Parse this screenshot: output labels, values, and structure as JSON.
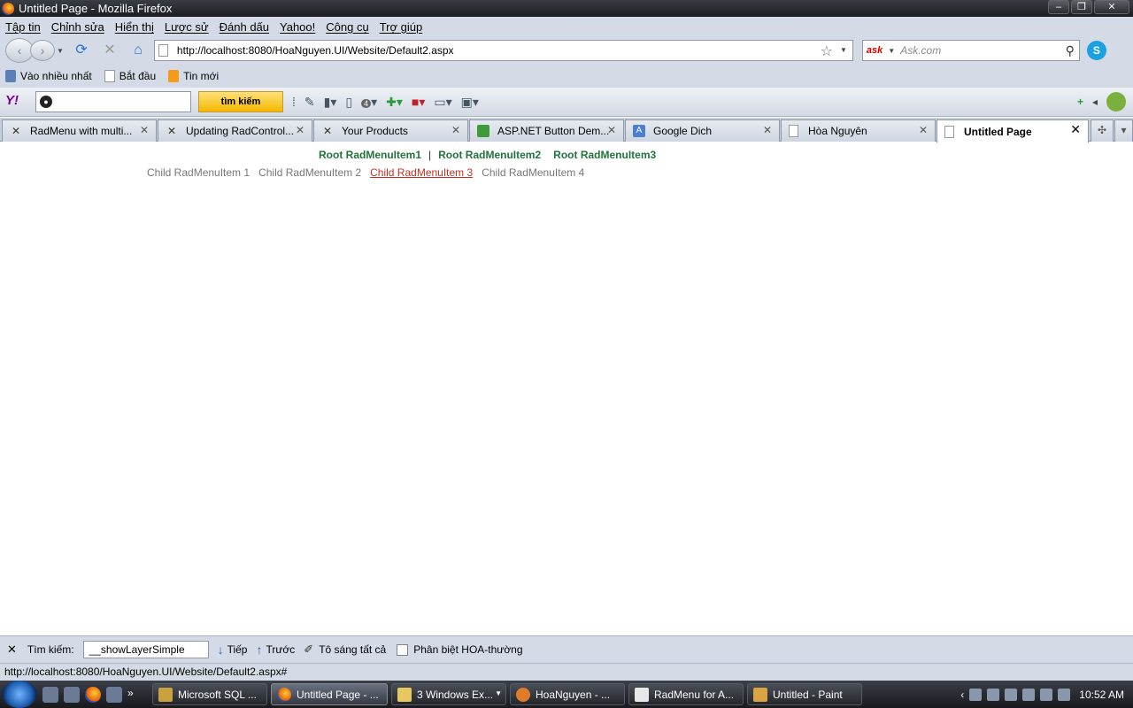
{
  "window": {
    "title": "Untitled Page - Mozilla Firefox",
    "min": "–",
    "max": "❐",
    "close": "✕"
  },
  "menubar": [
    "Tập tin",
    "Chỉnh sửa",
    "Hiển thị",
    "Lược sử",
    "Đánh dấu",
    "Yahoo!",
    "Công cụ",
    "Trợ giúp"
  ],
  "nav": {
    "url": "http://localhost:8080/HoaNguyen.UI/Website/Default2.aspx",
    "search_placeholder": "Ask.com"
  },
  "bookmarks": [
    "Vào nhiều nhất",
    "Bắt đầu",
    "Tin mới"
  ],
  "yahoo": {
    "logo": "Y!",
    "search_button": "tìm kiếm",
    "badge": "4"
  },
  "tabs": [
    {
      "label": "RadMenu with multi...",
      "icon": "telerik-icon"
    },
    {
      "label": "Updating RadControl...",
      "icon": "telerik-icon"
    },
    {
      "label": "Your Products",
      "icon": "telerik-icon"
    },
    {
      "label": "ASP.NET Button Dem...",
      "icon": "green-page-icon"
    },
    {
      "label": "Google Dich",
      "icon": "google-translate-icon"
    },
    {
      "label": "Hòa Nguyên",
      "icon": "page-icon"
    },
    {
      "label": "Untitled Page",
      "icon": "page-icon",
      "active": true
    }
  ],
  "page": {
    "root_items": [
      "Root RadMenuItem1",
      "Root RadMenuItem2",
      "Root RadMenuItem3"
    ],
    "root_separator": "|",
    "child_items": [
      "Child RadMenuItem 1",
      "Child RadMenuItem 2",
      "Child RadMenuItem 3",
      "Child RadMenuItem 4"
    ],
    "hovered_child": 2
  },
  "findbar": {
    "label": "Tìm kiếm:",
    "value": "__showLayerSimple",
    "next": "Tiếp",
    "prev": "Trước",
    "highlight": "Tô sáng tất cả",
    "match_case": "Phân biệt HOA-thường"
  },
  "status": "http://localhost:8080/HoaNguyen.UI/Website/Default2.aspx#",
  "taskbar": {
    "items": [
      {
        "label": "Microsoft SQL ...",
        "active": false
      },
      {
        "label": "Untitled Page - ...",
        "active": true
      },
      {
        "label": "3 Windows Ex...",
        "active": false
      },
      {
        "label": "HoaNguyen - ...",
        "active": false
      },
      {
        "label": "RadMenu for A...",
        "active": false
      },
      {
        "label": "Untitled - Paint",
        "active": false
      }
    ],
    "time": "10:52 AM"
  },
  "colors": {
    "root_menu": "#22733a",
    "child_hover": "#c62e1f",
    "child": "#777777"
  }
}
